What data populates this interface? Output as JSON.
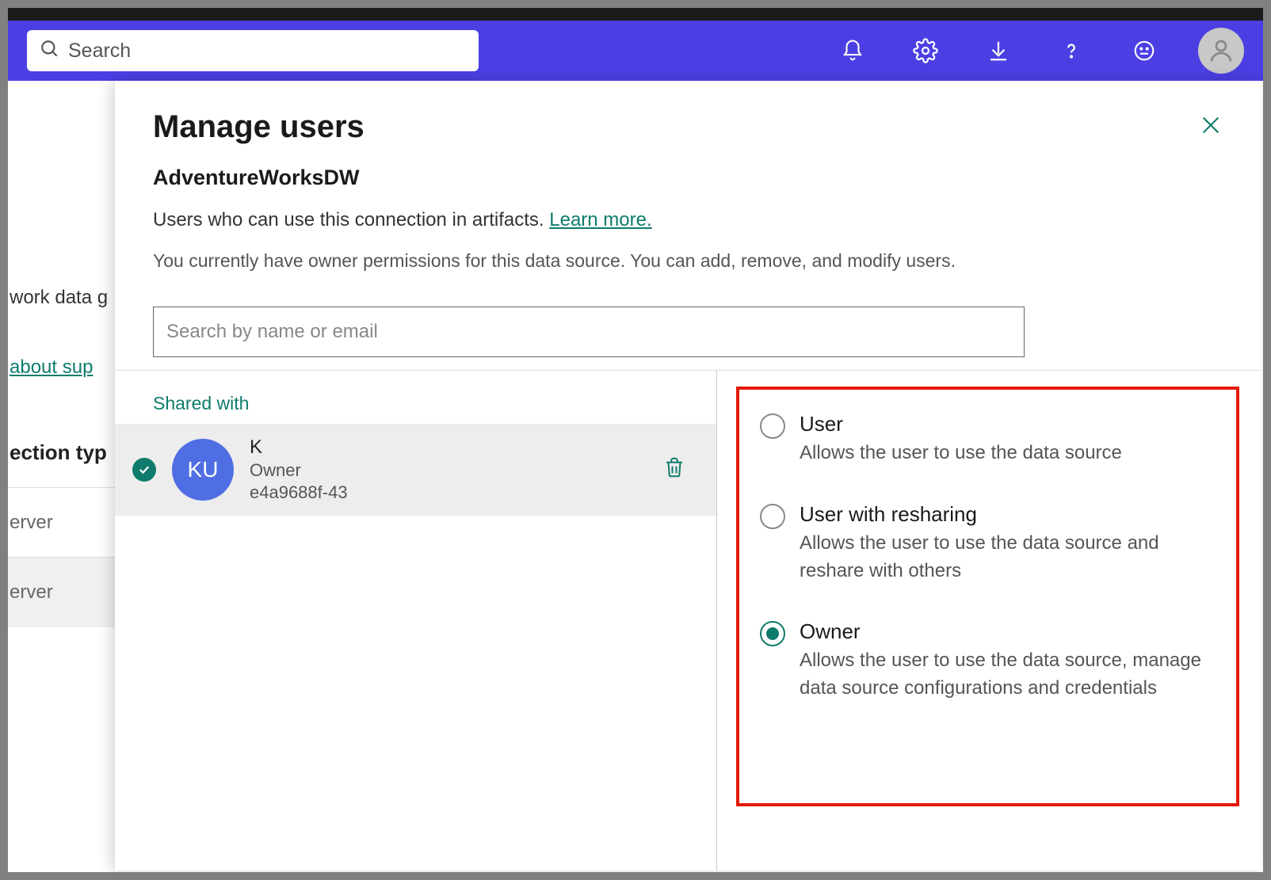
{
  "topbar": {
    "search_placeholder": "Search"
  },
  "background": {
    "row1": "work data g",
    "link_fragment": "about sup",
    "heading_fragment": "ection typ",
    "server1": "erver",
    "server2": "erver"
  },
  "modal": {
    "title": "Manage users",
    "subtitle": "AdventureWorksDW",
    "desc_prefix": "Users who can use this connection in artifacts. ",
    "learn_more": "Learn more.",
    "permissions_note": "You currently have owner permissions for this data source. You can add, remove, and modify users.",
    "search_placeholder": "Search by name or email",
    "tab_label": "Shared with",
    "user": {
      "initials": "KU",
      "name": "K",
      "role": "Owner",
      "id": "e4a9688f-43"
    },
    "roles": [
      {
        "title": "User",
        "desc": "Allows the user to use the data source",
        "selected": false
      },
      {
        "title": "User with resharing",
        "desc": "Allows the user to use the data source and reshare with others",
        "selected": false
      },
      {
        "title": "Owner",
        "desc": "Allows the user to use the data source, manage data source configurations and credentials",
        "selected": true
      }
    ]
  }
}
